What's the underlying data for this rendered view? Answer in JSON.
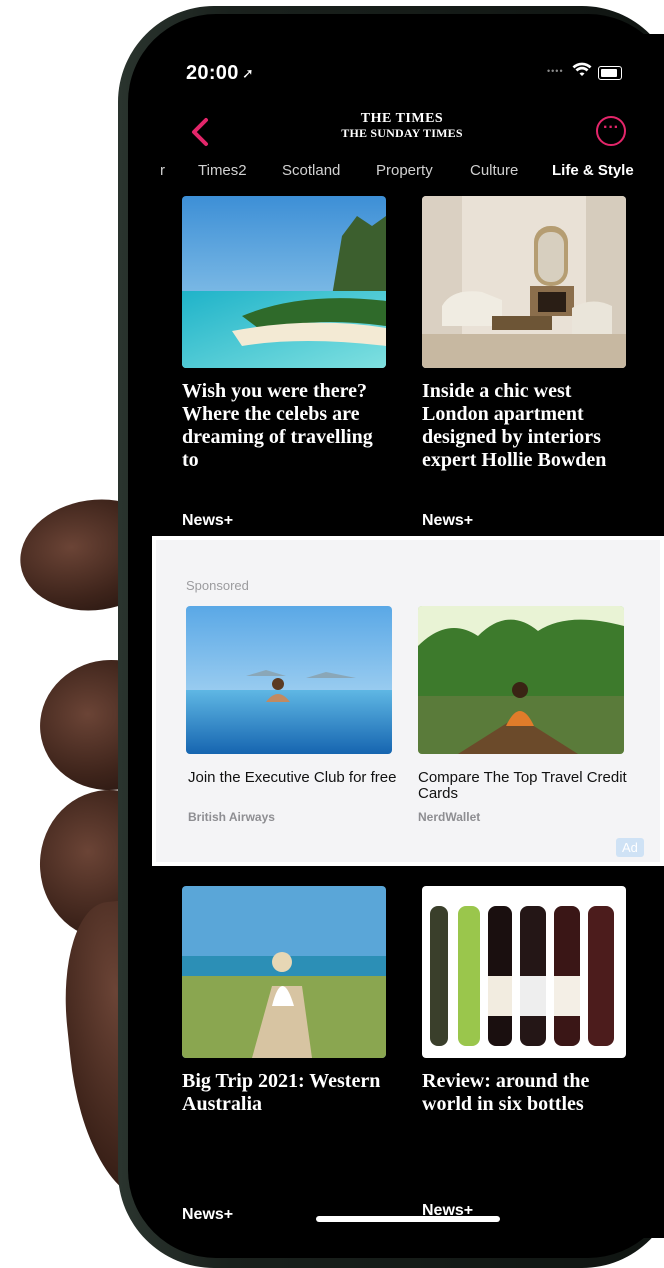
{
  "status_bar": {
    "time": "20:00",
    "location_icon": "location-arrow-icon",
    "wifi_icon": "wifi-icon",
    "battery_icon": "battery-icon"
  },
  "header": {
    "back_icon": "chevron-left-icon",
    "masthead_line1": "THE TIMES",
    "masthead_line2": "THE SUNDAY TIMES",
    "more_icon": "ellipsis-circle-icon",
    "accent_color": "#e3266a"
  },
  "tabs": [
    {
      "label": "r"
    },
    {
      "label": "Times2"
    },
    {
      "label": "Scotland"
    },
    {
      "label": "Property"
    },
    {
      "label": "Culture"
    },
    {
      "label": "Life & Style",
      "active": true
    }
  ],
  "articles_top": [
    {
      "headline": "Wish you were there? Where the celebs are dreaming of travelling to",
      "badge": "News+"
    },
    {
      "headline": "Inside a chic west London apartment designed by interiors expert Hollie Bowden",
      "badge": "News+"
    }
  ],
  "sponsored": {
    "label": "Sponsored",
    "ads": [
      {
        "title": "Join the Executive Club for free",
        "sponsor": "British Airways"
      },
      {
        "title": "Compare The Top Travel Credit Cards",
        "sponsor": "NerdWallet"
      }
    ],
    "ad_badge": "Ad"
  },
  "articles_bottom": [
    {
      "headline": "Big Trip 2021: Western Australia",
      "badge": "News+"
    },
    {
      "headline": "Review: around the world in six bottles",
      "badge": "News+"
    }
  ]
}
